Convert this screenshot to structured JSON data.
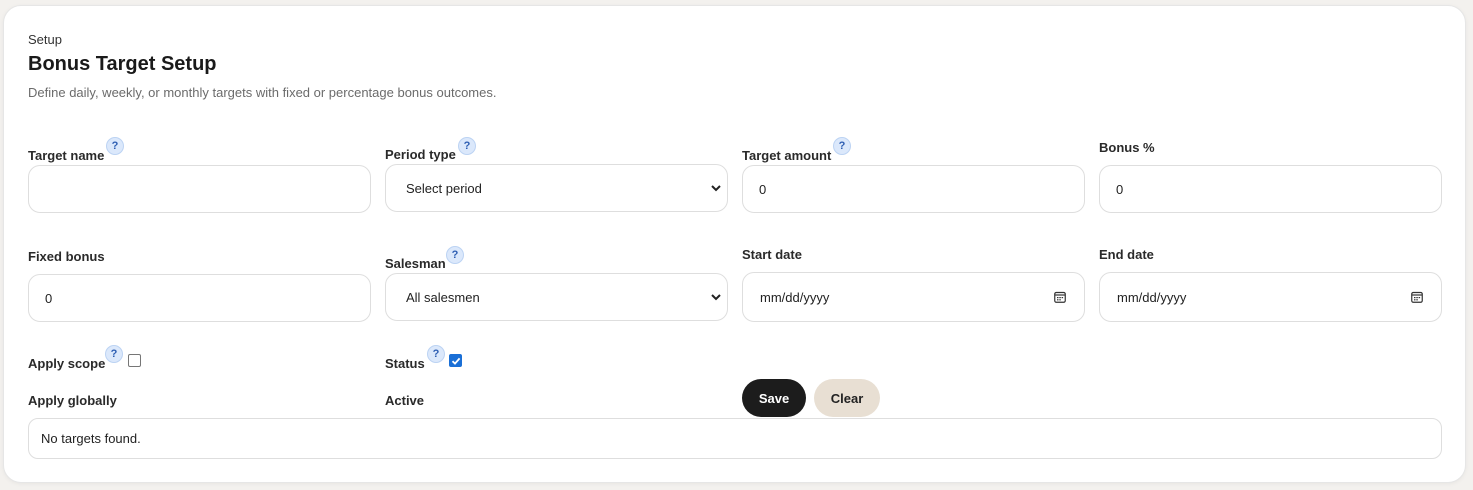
{
  "header": {
    "eyebrow": "Setup",
    "title": "Bonus Target Setup",
    "subtitle": "Define daily, weekly, or monthly targets with fixed or percentage bonus outcomes."
  },
  "help_glyph": "?",
  "fields": {
    "target_name": {
      "label": "Target name",
      "value": ""
    },
    "period_type": {
      "label": "Period type",
      "value": "Select period"
    },
    "target_amount": {
      "label": "Target amount",
      "value": "0"
    },
    "bonus_percent": {
      "label": "Bonus %",
      "value": "0"
    },
    "fixed_bonus": {
      "label": "Fixed bonus",
      "value": "0"
    },
    "salesman": {
      "label": "Salesman",
      "value": "All salesmen"
    },
    "start_date": {
      "label": "Start date",
      "placeholder": "mm/dd/yyyy"
    },
    "end_date": {
      "label": "End date",
      "placeholder": "mm/dd/yyyy"
    },
    "apply_scope": {
      "label": "Apply scope",
      "checked": false,
      "caption": "Apply globally"
    },
    "status": {
      "label": "Status",
      "checked": true,
      "caption": "Active"
    }
  },
  "actions": {
    "save_label": "Save",
    "clear_label": "Clear"
  },
  "empty_state": "No targets found.",
  "colors": {
    "primary_button": "#1c1c1c",
    "secondary_button": "#e8dfd3",
    "help_badge": "#dbe8fb",
    "checkbox_checked": "#1a6fd6"
  }
}
